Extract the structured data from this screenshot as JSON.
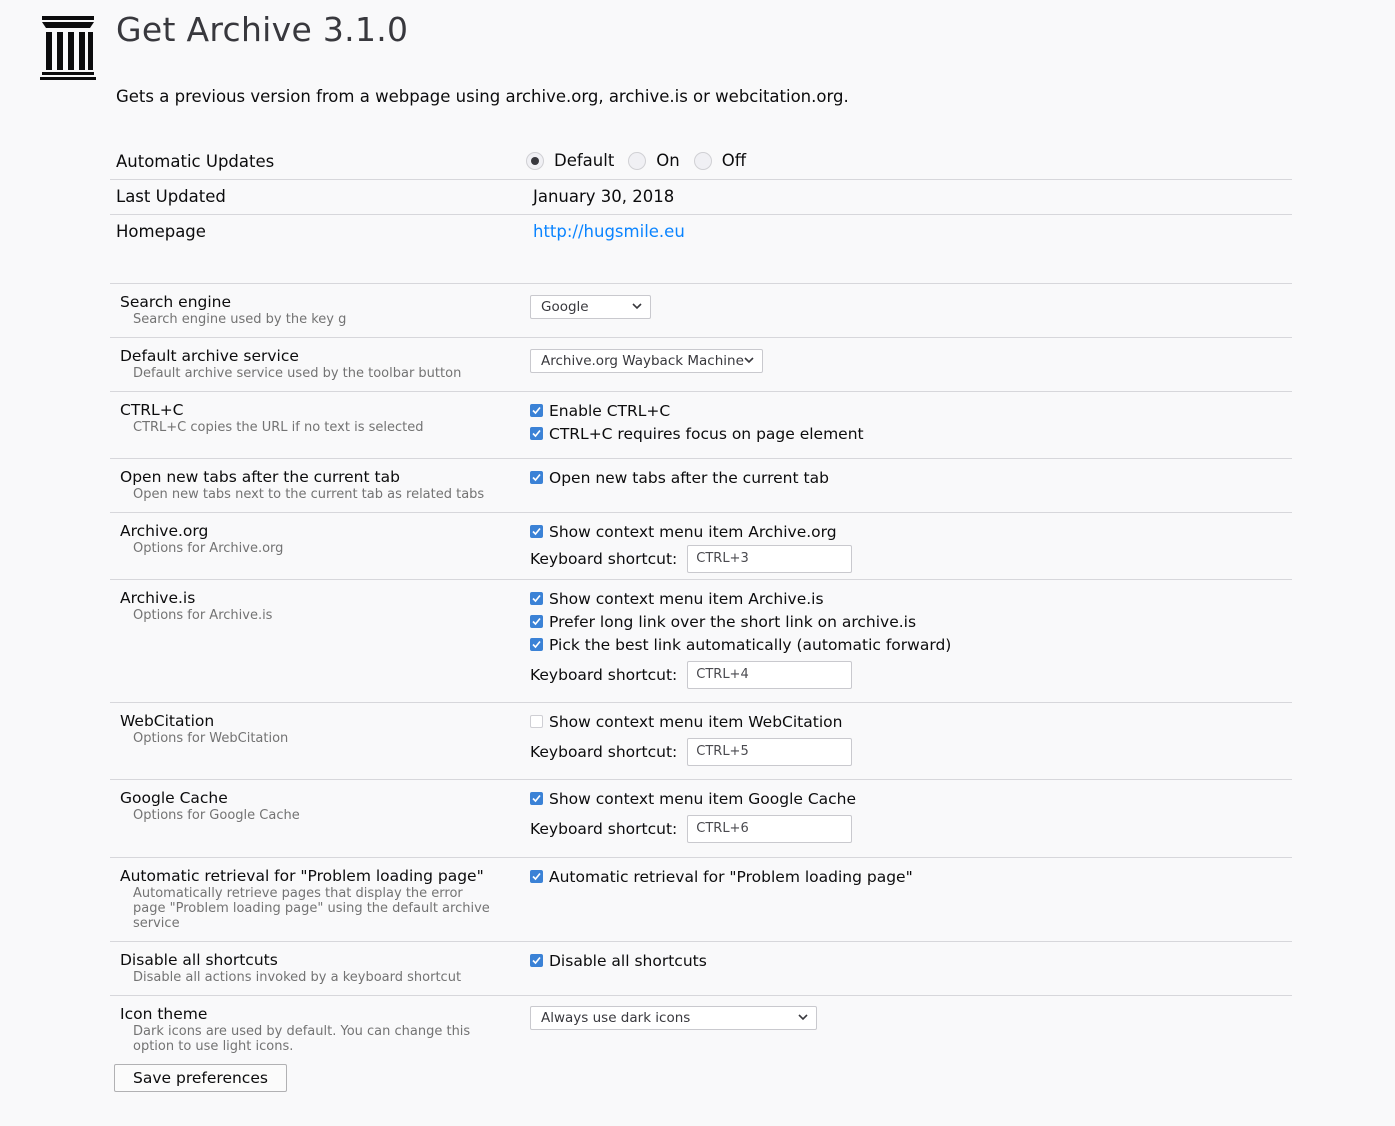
{
  "header": {
    "title": "Get Archive 3.1.0",
    "description": "Gets a previous version from a webpage using archive.org, archive.is or webcitation.org."
  },
  "details": {
    "auto_updates": {
      "label": "Automatic Updates",
      "options": [
        "Default",
        "On",
        "Off"
      ],
      "selected": "Default"
    },
    "last_updated": {
      "label": "Last Updated",
      "value": "January 30, 2018"
    },
    "homepage": {
      "label": "Homepage",
      "value": "http://hugsmile.eu"
    }
  },
  "options": {
    "search_engine": {
      "title": "Search engine",
      "desc": "Search engine used by the key g",
      "value": "Google"
    },
    "default_archive": {
      "title": "Default archive service",
      "desc": "Default archive service used by the toolbar button",
      "value": "Archive.org Wayback Machine"
    },
    "ctrlc": {
      "title": "CTRL+C",
      "desc": "CTRL+C copies the URL if no text is selected",
      "checkboxes": [
        {
          "label": "Enable CTRL+C",
          "checked": true
        },
        {
          "label": "CTRL+C requires focus on page element",
          "checked": true
        }
      ]
    },
    "new_tabs": {
      "title": "Open new tabs after the current tab",
      "desc": "Open new tabs next to the current tab as related tabs",
      "checkboxes": [
        {
          "label": "Open new tabs after the current tab",
          "checked": true
        }
      ]
    },
    "archive_org": {
      "title": "Archive.org",
      "desc": "Options for Archive.org",
      "checkboxes": [
        {
          "label": "Show context menu item Archive.org",
          "checked": true
        }
      ],
      "shortcut_label": "Keyboard shortcut:",
      "shortcut": "CTRL+3"
    },
    "archive_is": {
      "title": "Archive.is",
      "desc": "Options for Archive.is",
      "checkboxes": [
        {
          "label": "Show context menu item Archive.is",
          "checked": true
        },
        {
          "label": "Prefer long link over the short link on archive.is",
          "checked": true
        },
        {
          "label": "Pick the best link automatically (automatic forward)",
          "checked": true
        }
      ],
      "shortcut_label": "Keyboard shortcut:",
      "shortcut": "CTRL+4"
    },
    "webcitation": {
      "title": "WebCitation",
      "desc": "Options for WebCitation",
      "checkboxes": [
        {
          "label": "Show context menu item WebCitation",
          "checked": false
        }
      ],
      "shortcut_label": "Keyboard shortcut:",
      "shortcut": "CTRL+5"
    },
    "google_cache": {
      "title": "Google Cache",
      "desc": "Options for Google Cache",
      "checkboxes": [
        {
          "label": "Show context menu item Google Cache",
          "checked": true
        }
      ],
      "shortcut_label": "Keyboard shortcut:",
      "shortcut": "CTRL+6"
    },
    "auto_retrieval": {
      "title": "Automatic retrieval for \"Problem loading page\"",
      "desc_lines": [
        "Automatically retrieve pages that display the error",
        "page \"Problem loading page\" using the default archive",
        "service"
      ],
      "checkboxes": [
        {
          "label": "Automatic retrieval for \"Problem loading page\"",
          "checked": true
        }
      ]
    },
    "disable_shortcuts": {
      "title": "Disable all shortcuts",
      "desc": "Disable all actions invoked by a keyboard shortcut",
      "checkboxes": [
        {
          "label": "Disable all shortcuts",
          "checked": true
        }
      ]
    },
    "icon_theme": {
      "title": "Icon theme",
      "desc_lines": [
        "Dark icons are used by default. You can change this",
        "option to use light icons."
      ],
      "value": "Always use dark icons"
    }
  },
  "save_label": "Save preferences",
  "colors": {
    "background": "#f9f9fa",
    "checkbox_checked": "#3b82d6",
    "link": "#0a84ff"
  },
  "icons": {
    "logo": "archive-building-icon",
    "dropdown": "chevron-down-icon",
    "check": "checkmark-icon"
  }
}
